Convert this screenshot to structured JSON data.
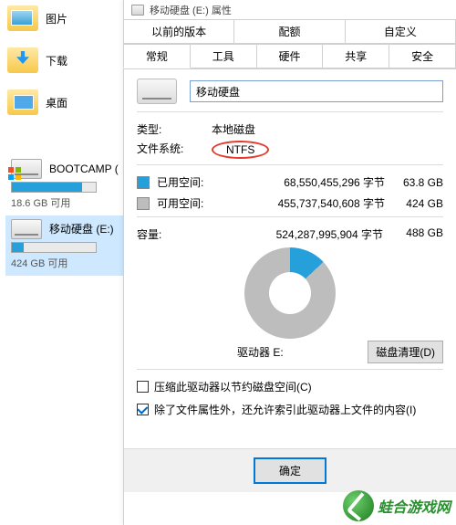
{
  "explorer": {
    "nav": [
      {
        "label": "图片"
      },
      {
        "label": "下载"
      },
      {
        "label": "桌面"
      }
    ],
    "drives": [
      {
        "name": "BOOTCAMP (",
        "sub": "18.6 GB 可用",
        "fill_pct": 84,
        "selected": false,
        "win": true
      },
      {
        "name": "移动硬盘 (E:)",
        "sub": "424 GB 可用",
        "fill_pct": 14,
        "selected": true,
        "win": false
      }
    ]
  },
  "dialog": {
    "title": "移动硬盘 (E:) 属性",
    "tabs_row1": [
      "以前的版本",
      "配额",
      "自定义"
    ],
    "tabs_row2": [
      "常规",
      "工具",
      "硬件",
      "共享",
      "安全"
    ],
    "active_tab": "常规",
    "drive_name": "移动硬盘",
    "type_label": "类型:",
    "type_value": "本地磁盘",
    "fs_label": "文件系统:",
    "fs_value": "NTFS",
    "used_label": "已用空间:",
    "used_bytes": "68,550,455,296 字节",
    "used_h": "63.8 GB",
    "free_label": "可用空间:",
    "free_bytes": "455,737,540,608 字节",
    "free_h": "424 GB",
    "cap_label": "容量:",
    "cap_bytes": "524,287,995,904 字节",
    "cap_h": "488 GB",
    "drive_letter_label": "驱动器 E:",
    "cleanup_btn": "磁盘清理(D)",
    "compress_label": "压缩此驱动器以节约磁盘空间(C)",
    "index_label": "除了文件属性外，还允许索引此驱动器上文件的内容(I)",
    "ok": "确定"
  },
  "watermark": "蛙合游戏网",
  "chart_data": {
    "type": "pie",
    "title": "驱动器 E:",
    "series": [
      {
        "name": "已用空间",
        "value_bytes": 68550455296,
        "value_h": "63.8 GB",
        "color": "#26a0da"
      },
      {
        "name": "可用空间",
        "value_bytes": 455737540608,
        "value_h": "424 GB",
        "color": "#bdbdbd"
      }
    ],
    "total_bytes": 524287995904,
    "total_h": "488 GB"
  }
}
